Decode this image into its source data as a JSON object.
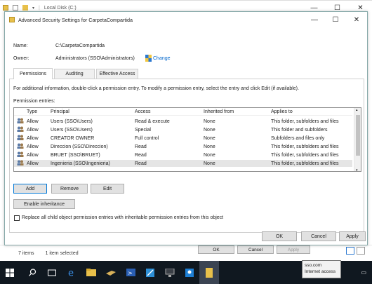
{
  "explorer": {
    "title": "Local Disk (C:)",
    "status_items": "7 items",
    "status_selected": "1 item selected"
  },
  "hidden_dialog": {
    "ok": "OK",
    "cancel": "Cancel",
    "apply": "Apply"
  },
  "dialog": {
    "title": "Advanced Security Settings for CarpetaCompartida",
    "name_label": "Name:",
    "name_value": "C:\\CarpetaCompartida",
    "owner_label": "Owner:",
    "owner_value": "Administrators (SSO\\Administrators)",
    "change_link": "Change",
    "tabs": [
      {
        "label": "Permissions",
        "active": true
      },
      {
        "label": "Auditing",
        "active": false
      },
      {
        "label": "Effective Access",
        "active": false
      }
    ],
    "info_text": "For additional information, double-click a permission entry. To modify a permission entry, select the entry and click Edit (if available).",
    "entries_label": "Permission entries:",
    "columns": [
      "Type",
      "Principal",
      "Access",
      "Inherited from",
      "Applies to"
    ],
    "rows": [
      {
        "type": "Allow",
        "principal": "Users (SSO\\Users)",
        "access": "Read & execute",
        "inherited": "None",
        "applies": "This folder, subfolders and files",
        "selected": false
      },
      {
        "type": "Allow",
        "principal": "Users (SSO\\Users)",
        "access": "Special",
        "inherited": "None",
        "applies": "This folder and subfolders",
        "selected": false
      },
      {
        "type": "Allow",
        "principal": "CREATOR OWNER",
        "access": "Full control",
        "inherited": "None",
        "applies": "Subfolders and files only",
        "selected": false
      },
      {
        "type": "Allow",
        "principal": "Direccion (SSO\\Direccion)",
        "access": "Read",
        "inherited": "None",
        "applies": "This folder, subfolders and files",
        "selected": false
      },
      {
        "type": "Allow",
        "principal": "BRUET (SSO\\BRUET)",
        "access": "Read",
        "inherited": "None",
        "applies": "This folder, subfolders and files",
        "selected": false
      },
      {
        "type": "Allow",
        "principal": "Ingenieria (SSO\\Ingenieria)",
        "access": "Read",
        "inherited": "None",
        "applies": "This folder, subfolders and files",
        "selected": true
      }
    ],
    "add_button": "Add",
    "remove_button": "Remove",
    "edit_button": "Edit",
    "enable_inheritance_button": "Enable inheritance",
    "replace_checkbox_label": "Replace all child object permission entries with inheritable permission entries from this object",
    "ok_button": "OK",
    "cancel_button": "Cancel",
    "apply_button": "Apply"
  },
  "tooltip": {
    "line1": "sso.com",
    "line2": "Internet access"
  },
  "colors": {
    "accent": "#0078d7",
    "taskbar": "#101820",
    "selected_row": "#e5e5e5"
  }
}
